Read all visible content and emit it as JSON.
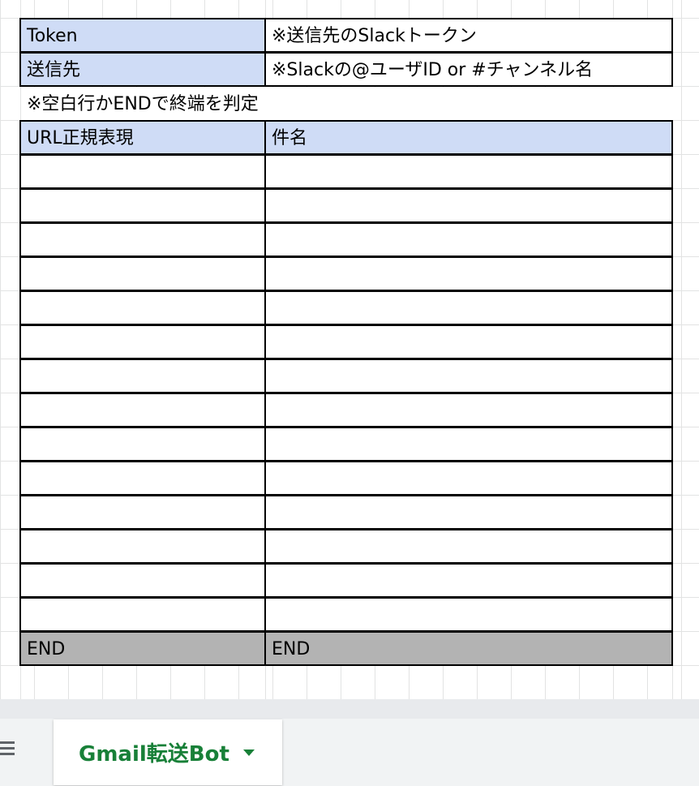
{
  "settings": {
    "token_label": "Token",
    "token_value": "※送信先のSlackトークン",
    "dest_label": "送信先",
    "dest_value": "※Slackの@ユーザID or #チャンネル名"
  },
  "note": "※空白行かENDで終端を判定",
  "table": {
    "headers": [
      "URL正規表現",
      "件名"
    ],
    "empty_rows": 14,
    "end_row": [
      "END",
      "END"
    ]
  },
  "sheet_tabs": [
    {
      "label": "Gmail転送Bot",
      "active": true
    }
  ],
  "colors": {
    "header_bg": "#cfdcf6",
    "end_bg": "#b3b3b3",
    "tab_text": "#188038"
  }
}
